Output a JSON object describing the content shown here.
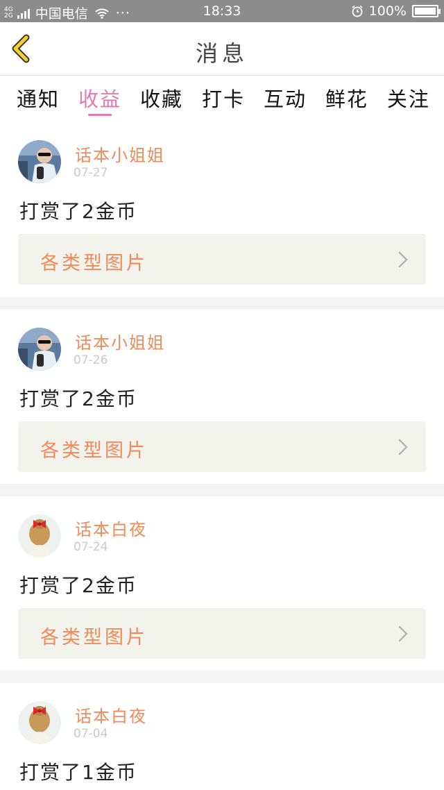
{
  "status_bar": {
    "network_top": "4G",
    "network_bottom": "2G",
    "carrier": "中国电信",
    "more": "···",
    "time": "18:33",
    "battery": "100%"
  },
  "nav": {
    "title": "消息"
  },
  "tabs": [
    {
      "label": "通知",
      "active": false
    },
    {
      "label": "收益",
      "active": true
    },
    {
      "label": "收藏",
      "active": false
    },
    {
      "label": "打卡",
      "active": false
    },
    {
      "label": "互动",
      "active": false
    },
    {
      "label": "鲜花",
      "active": false
    },
    {
      "label": "关注",
      "active": false
    }
  ],
  "messages": [
    {
      "username": "话本小姐姐",
      "date": "07-27",
      "text": "打赏了2金币",
      "ref": "各类型图片",
      "avatar": "sunglasses-person"
    },
    {
      "username": "话本小姐姐",
      "date": "07-26",
      "text": "打赏了2金币",
      "ref": "各类型图片",
      "avatar": "sunglasses-person"
    },
    {
      "username": "话本白夜",
      "date": "07-24",
      "text": "打赏了2金币",
      "ref": "各类型图片",
      "avatar": "hair-bun-bow"
    },
    {
      "username": "话本白夜",
      "date": "07-04",
      "text": "打赏了1金币",
      "ref": "",
      "avatar": "hair-bun-bow"
    }
  ],
  "colors": {
    "accent_pink": "#e07ab0",
    "username_orange": "#f08a5a",
    "status_bar": "#8c8c8c",
    "back_arrow": "#f5d02a"
  }
}
